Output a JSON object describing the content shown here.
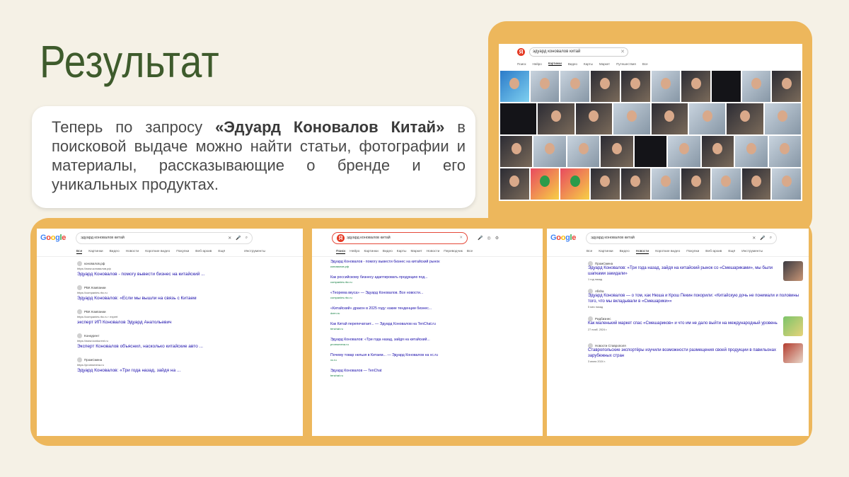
{
  "slide": {
    "title": "Результат",
    "text_prefix": "Теперь по запросу ",
    "text_bold": "«Эдуард Коновалов Китай»",
    "text_suffix": " в поисковой выдаче можно найти статьи, фотографии и материалы, рассказывающие о бренде и его уникальных продуктах."
  },
  "yandex_images": {
    "query": "эдуард коновалов китай",
    "tabs": [
      "Поиск",
      "Нейро",
      "Картинки",
      "Видео",
      "Карты",
      "Маркет",
      "Путешествия",
      "Все"
    ],
    "active_tab": "Картинки"
  },
  "google_all": {
    "query": "эдуард коновалов китай",
    "tabs": [
      "Все",
      "Картинки",
      "Видео",
      "Новости",
      "Короткие видео",
      "Покупки",
      "Веб-архив",
      "Ещё",
      "Инструменты"
    ],
    "results": [
      {
        "source": "коновалов.рф",
        "url": "https://www.коновалов.рф",
        "title": "Эдуард Коновалов - помогу вывести бизнес на китайский ..."
      },
      {
        "source": "РБК Компании",
        "url": "https://companies.rbc.ru",
        "title": "Эдуард Коновалов: «Если мы вышли на связь с Китаем"
      },
      {
        "source": "РБК Компании",
        "url": "https://companies.rbc.ru › expert",
        "title": "эксперт ИП Коновалов Эдуард Анатольевич"
      },
      {
        "source": "Конкурент",
        "url": "https://www.konkurent.ru",
        "title": "Эксперт Коновалов объяснил, насколько китайские авто ..."
      },
      {
        "source": "ПромСмена",
        "url": "https://promsmena.ru",
        "title": "Эдуард Коновалов: «Три года назад, зайдя на ..."
      }
    ]
  },
  "yandex_web": {
    "query": "эдуард коновалов китай",
    "tabs": [
      "Поиск",
      "Нейро",
      "Картинки",
      "Видео",
      "Карты",
      "Маркет",
      "Новости",
      "Переводчик",
      "Все"
    ],
    "results": [
      {
        "title": "Эдуард Коновалов - помогу вывести бизнес на китайский рынок",
        "url": "коновалов.рф"
      },
      {
        "title": "Как российскому бизнесу адаптировать продукцию под...",
        "url": "companies.rbc.ru"
      },
      {
        "title": "«Теорема вкуса» — Эдуард Коновалов. Все новости...",
        "url": "companies.rbc.ru"
      },
      {
        "title": "«Китайский» дракон в 2025 году: какие тенденции бизнес...",
        "url": "dzen.ru"
      },
      {
        "title": "Как Китай перепечатает... — Эдуард Коновалов на TenChat.ru",
        "url": "tenchat.ru"
      },
      {
        "title": "Эдуард Коновалов: «Три года назад, зайдя на китайский...",
        "url": "promsmena.ru"
      },
      {
        "title": "Почему товар нельзя в Китаем... — Эдуард Коновалов на vc.ru",
        "url": "vc.ru"
      },
      {
        "title": "Эдуард Коновалов — TenChat",
        "url": "tenchat.ru"
      }
    ]
  },
  "google_news": {
    "query": "эдуард коновалов китай",
    "tabs": [
      "Все",
      "Картинки",
      "Видео",
      "Новости",
      "Короткие видео",
      "Покупки",
      "Веб-архив",
      "Ещё",
      "Инструменты"
    ],
    "results": [
      {
        "source": "ПромСмена",
        "title": "Эдуард Коновалов: «Три года назад, зайдя на китайский рынок со «Смешариками», мы были шапками закидали»",
        "date": "1 год назад"
      },
      {
        "source": "Afisha",
        "title": "Эдуард Коновалов — о том, как Нюша и Крош Пекин покорили: «Китайскую дочь не понимали и половины того, что мы вкладывали в «Смешарики»»",
        "date": "5 мес назад"
      },
      {
        "source": "Ридбизнес",
        "title": "Как маленький маркет спас «Смешариков» и что им не дало выйти на международный уровень",
        "date": "27 нояб. 2024 г."
      },
      {
        "source": "Новости Ставрополя",
        "title": "Ставропольские экспортёры изучили возможности размещения своей продукции в павильонах зарубежных стран",
        "date": "3 июня 2024 г."
      }
    ]
  },
  "colors": {
    "accent": "#edb75c",
    "title": "#3e5b2c",
    "link": "#1a0dab",
    "background": "#f5f1e6"
  }
}
